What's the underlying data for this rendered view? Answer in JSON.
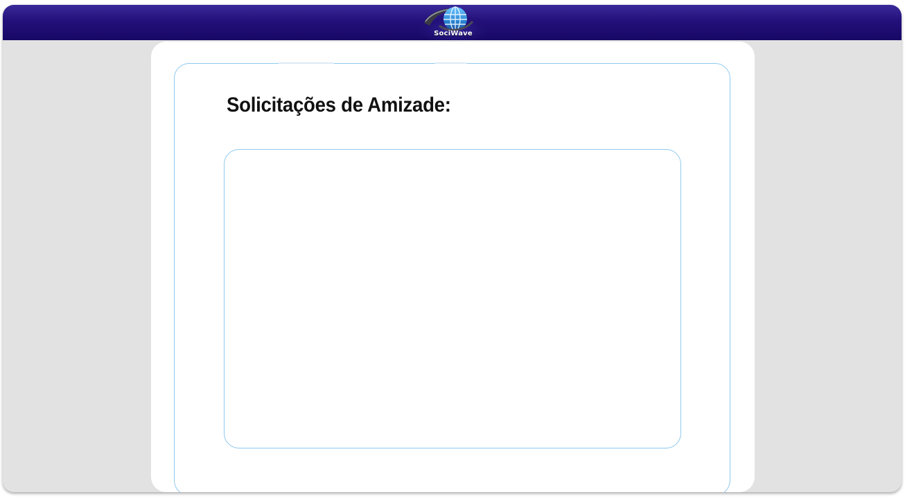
{
  "header": {
    "logo_text": "SociWave",
    "logo_icon": "globe-icon",
    "colors": {
      "bar_top": "#3a2a9a",
      "bar_bottom": "#170865",
      "globe": "#2f8fd8"
    }
  },
  "main": {
    "title": "Solicitações de Amizade:",
    "requests": []
  },
  "colors": {
    "background": "#e2e2e2",
    "card": "#ffffff",
    "border_accent": "#8ec8ee"
  }
}
